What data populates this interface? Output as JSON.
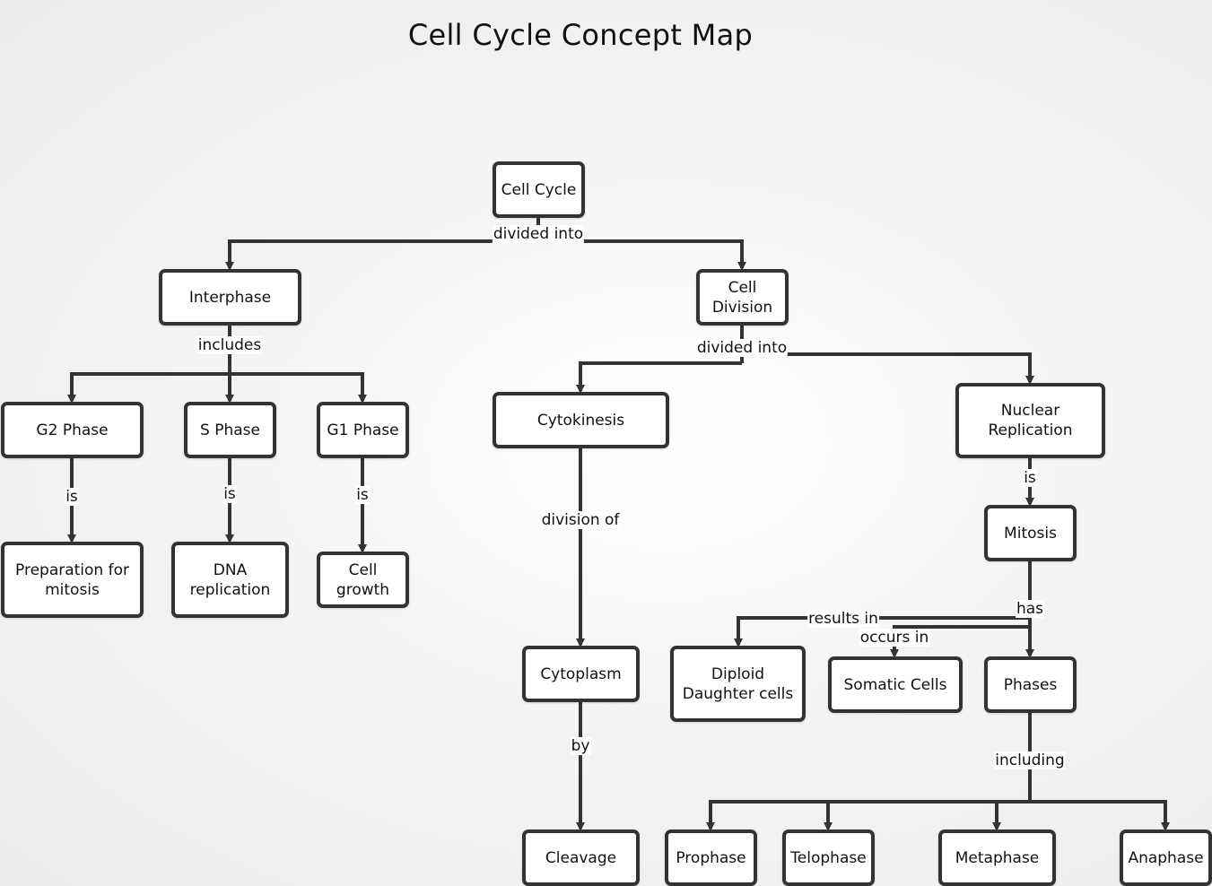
{
  "title": "Cell Cycle Concept Map",
  "colors": {
    "stroke": "#333333",
    "node_fill": "#ffffff",
    "text": "#111111"
  },
  "nodes": {
    "cell_cycle": "Cell Cycle",
    "interphase": "Interphase",
    "cell_division": "Cell\nDivision",
    "g2_phase": "G2 Phase",
    "s_phase": "S Phase",
    "g1_phase": "G1 Phase",
    "prep_mitosis": "Preparation for\nmitosis",
    "dna_replication": "DNA\nreplication",
    "cell_growth": "Cell\ngrowth",
    "cytokinesis": "Cytokinesis",
    "cytoplasm": "Cytoplasm",
    "cleavage": "Cleavage",
    "nuclear_replication": "Nuclear\nReplication",
    "mitosis": "Mitosis",
    "diploid": "Diploid\nDaughter cells",
    "somatic": "Somatic Cells",
    "phases": "Phases",
    "prophase": "Prophase",
    "telophase": "Telophase",
    "metaphase": "Metaphase",
    "anaphase": "Anaphase"
  },
  "links": {
    "cycle_divided_into": "divided into",
    "interphase_includes": "includes",
    "g2_is": "is",
    "s_is": "is",
    "g1_is": "is",
    "division_divided_into": "divided into",
    "cytokinesis_division_of": "division of",
    "cytoplasm_by": "by",
    "nuclear_is": "is",
    "mitosis_has": "has",
    "mitosis_results_in": "results in",
    "mitosis_occurs_in": "occurs in",
    "phases_including": "including"
  }
}
